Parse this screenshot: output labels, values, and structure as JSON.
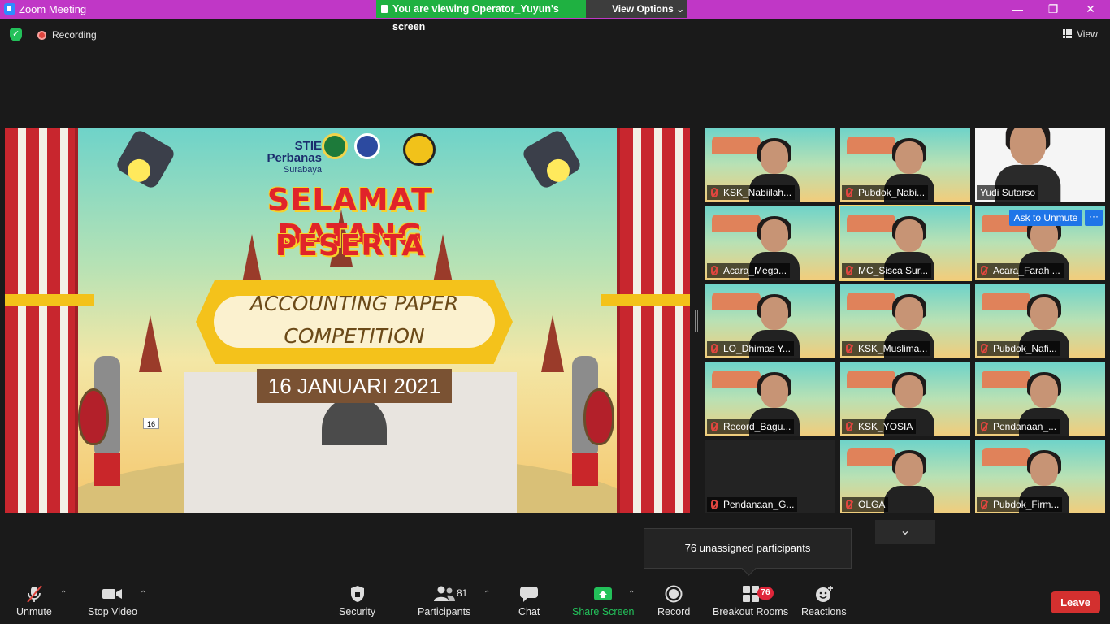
{
  "window": {
    "title": "Zoom Meeting",
    "viewing_banner": "You are viewing Operator_Yuyun's screen",
    "view_options": "View Options ⌄",
    "minimize": "—",
    "restore": "❐",
    "close": "✕"
  },
  "status": {
    "recording_label": "Recording",
    "view_label": "View"
  },
  "shared_screen": {
    "logo_text_line1": "STIE",
    "logo_text_line2": "Perbanas",
    "logo_text_line3": "Surabaya",
    "headline_line1": "SELAMAT DATANG",
    "headline_line2": "PESERTA",
    "banner_line1": "ACCOUNTING PAPER",
    "banner_line2": "COMPETITION",
    "date": "16 JANUARI 2021",
    "page_number": "16"
  },
  "gallery": {
    "ask_to_unmute": "Ask to Unmute",
    "more": "···",
    "tiles": [
      {
        "name": "KSK_Nabiilah...",
        "muted": true
      },
      {
        "name": "Pubdok_Nabi...",
        "muted": true
      },
      {
        "name": "Yudi Sutarso",
        "muted": false
      },
      {
        "name": "Acara_Mega...",
        "muted": true
      },
      {
        "name": "MC_Sisca Sur...",
        "muted": true
      },
      {
        "name": "Acara_Farah ...",
        "muted": true
      },
      {
        "name": "LO_Dhimas Y...",
        "muted": true
      },
      {
        "name": "KSK_Muslima...",
        "muted": true
      },
      {
        "name": "Pubdok_Nafi...",
        "muted": true
      },
      {
        "name": "Record_Bagu...",
        "muted": true
      },
      {
        "name": "KSK_YOSIA",
        "muted": true
      },
      {
        "name": "Pendanaan_...",
        "muted": true
      },
      {
        "name": "Pendanaan_G...",
        "muted": true
      },
      {
        "name": "OLGA",
        "muted": true
      },
      {
        "name": "Pubdok_Firm...",
        "muted": true
      }
    ],
    "scroll_down": "⌄"
  },
  "toast": {
    "text": "76 unassigned participants"
  },
  "toolbar": {
    "unmute": "Unmute",
    "stop_video": "Stop Video",
    "security": "Security",
    "participants": "Participants",
    "participants_count": "81",
    "chat": "Chat",
    "share_screen": "Share Screen",
    "record": "Record",
    "breakout_rooms": "Breakout Rooms",
    "breakout_badge": "76",
    "reactions": "Reactions",
    "leave": "Leave",
    "caret": "⌃"
  },
  "colors": {
    "title_bar": "#c037c6",
    "viewing_green": "#1fb141",
    "leave_red": "#d3302f",
    "share_green": "#23c15a",
    "ask_unmute_blue": "#1f75e8"
  }
}
